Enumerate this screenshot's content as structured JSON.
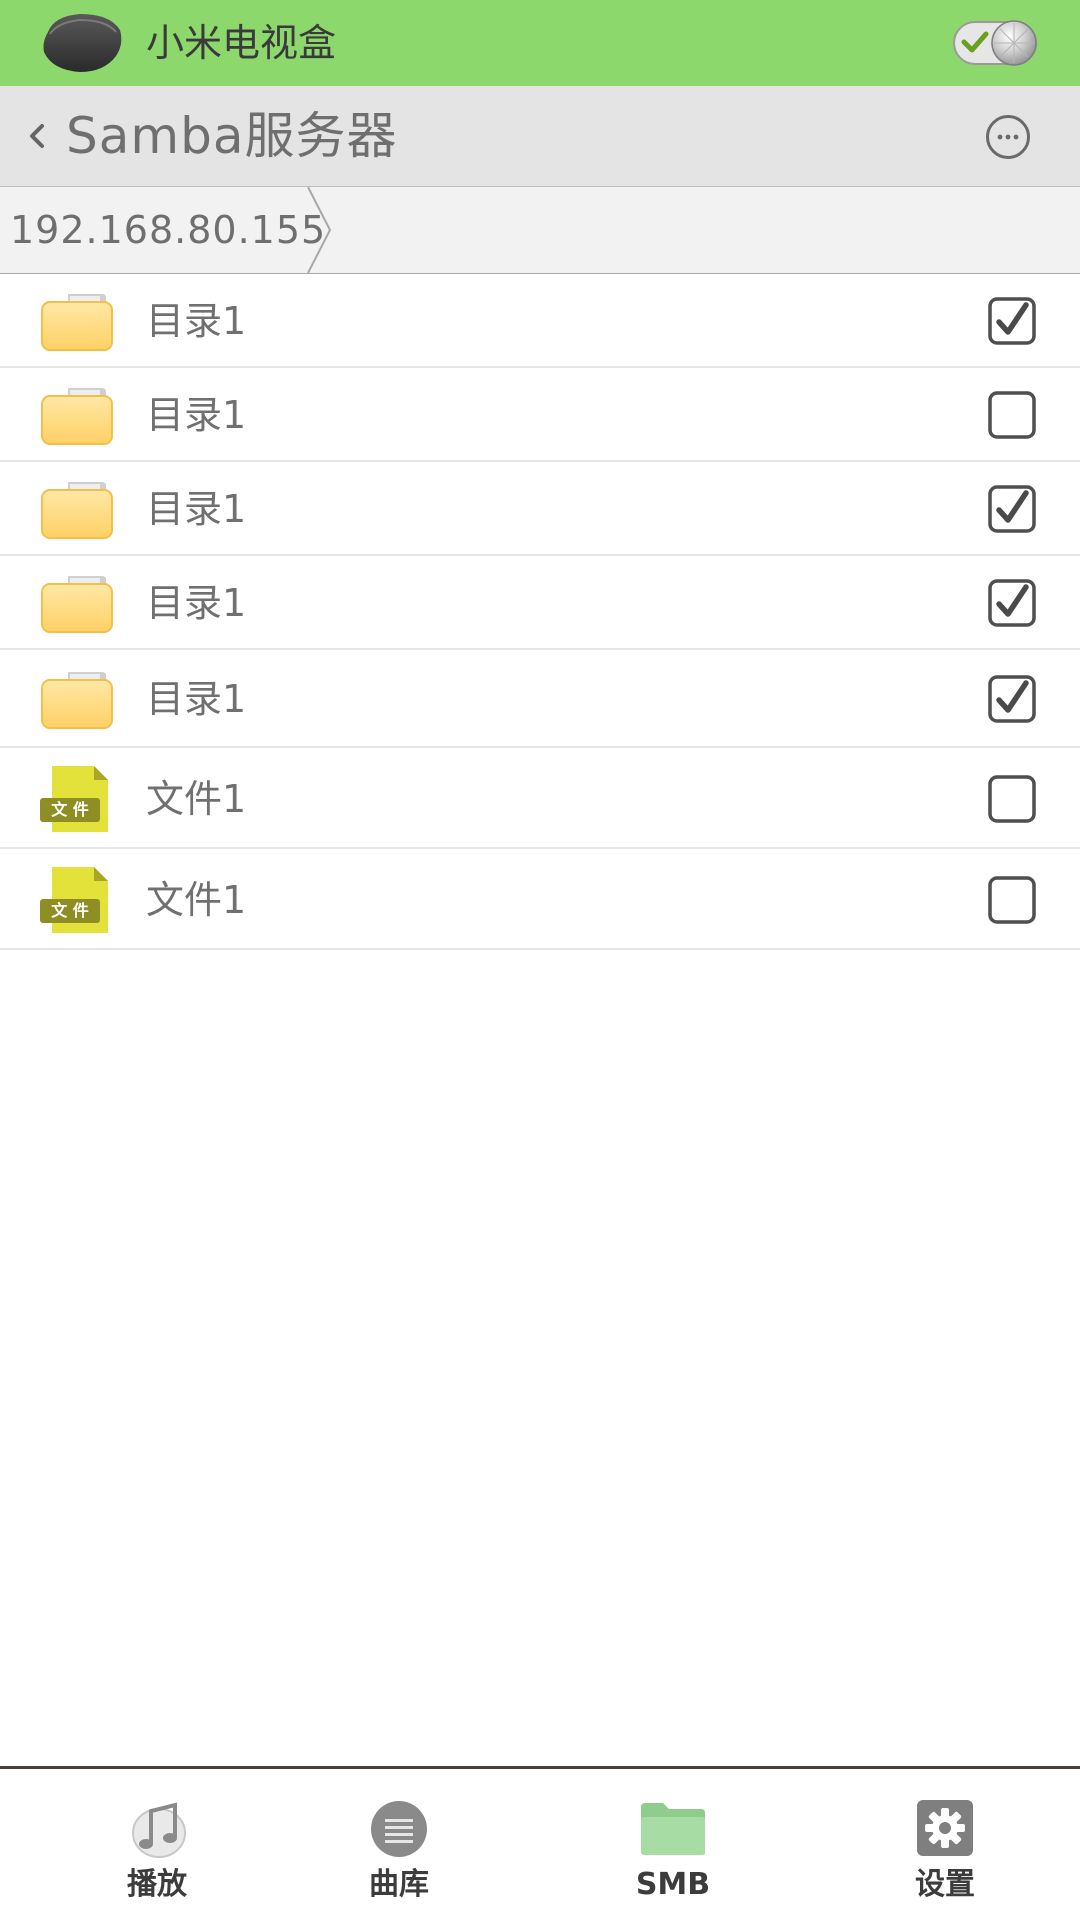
{
  "device_bar": {
    "name": "小米电视盒",
    "background": "#8dd86d",
    "toggle_icon": "connected-toggle-icon"
  },
  "header": {
    "back_icon": "chevron-left-icon",
    "title": "Samba服务器",
    "more_icon": "more-icon"
  },
  "breadcrumb": {
    "path": "192.168.80.155"
  },
  "items": [
    {
      "type": "folder",
      "name": "目录1",
      "checked": true
    },
    {
      "type": "folder",
      "name": "目录1",
      "checked": false
    },
    {
      "type": "folder",
      "name": "目录1",
      "checked": true
    },
    {
      "type": "folder",
      "name": "目录1",
      "checked": true
    },
    {
      "type": "folder",
      "name": "目录1",
      "checked": true
    },
    {
      "type": "file",
      "name": "文件1",
      "badge": "文 件",
      "checked": false
    },
    {
      "type": "file",
      "name": "文件1",
      "badge": "文 件",
      "checked": false
    }
  ],
  "bottom_nav": {
    "play": {
      "label": "播放",
      "icon": "music-note-icon"
    },
    "library": {
      "label": "曲库",
      "icon": "list-icon"
    },
    "smb": {
      "label": "SMB",
      "icon": "folder-icon",
      "active": true
    },
    "settings": {
      "label": "设置",
      "icon": "gear-icon"
    }
  },
  "colors": {
    "accent_green": "#8dd86d",
    "header_bg": "#e4e4e4",
    "folder_yellow": "#ffd36b",
    "file_yellow": "#e3e23a"
  }
}
